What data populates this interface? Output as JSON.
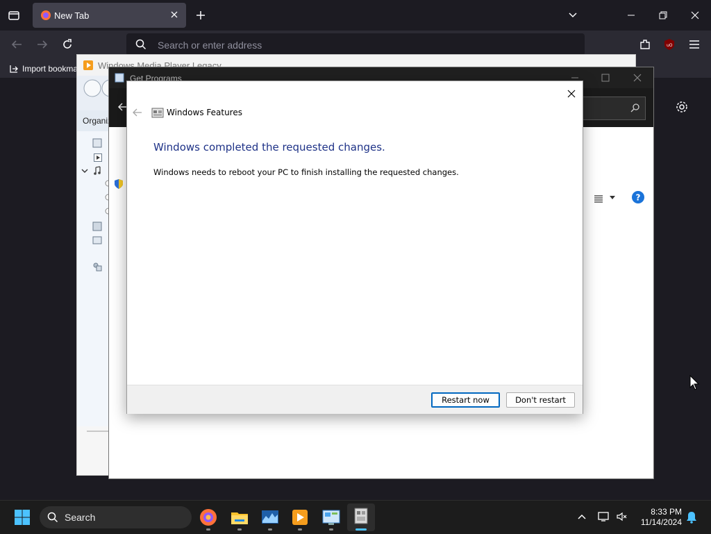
{
  "browser": {
    "tab_title": "New Tab",
    "address_placeholder": "Search or enter address",
    "bookmark_item": "Import bookmarks..."
  },
  "wmp": {
    "title": "Windows Media Player Legacy",
    "organize_label": "Organize"
  },
  "get_programs": {
    "title": "Get Programs"
  },
  "dialog": {
    "title": "Windows Features",
    "heading": "Windows completed the requested changes.",
    "message": "Windows needs to reboot your PC to finish installing the requested changes.",
    "restart_button": "Restart now",
    "dont_restart_button": "Don't restart"
  },
  "taskbar": {
    "search_label": "Search",
    "time": "8:33 PM",
    "date": "11/14/2024"
  },
  "colors": {
    "heading_blue": "#1e3287",
    "accent": "#0067c0",
    "browser_dark": "#1c1b22"
  }
}
